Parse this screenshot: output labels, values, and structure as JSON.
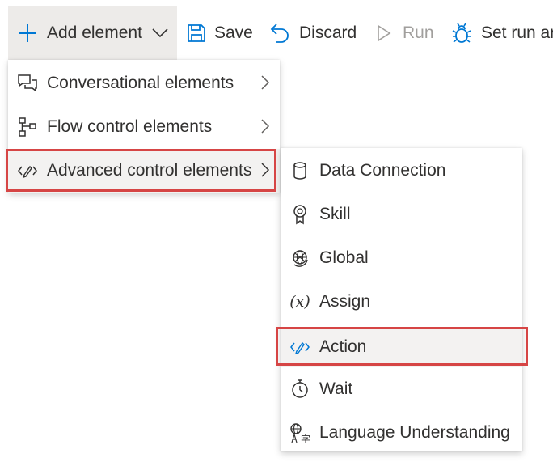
{
  "colors": {
    "accent": "#0078d4",
    "text": "#323130",
    "disabled": "#a19f9d",
    "highlight_outline": "#d64545",
    "hover_bg": "#f3f2f1",
    "pressed_bg": "#edebe9"
  },
  "toolbar": {
    "add_element": {
      "label": "Add element",
      "icon": "plus-icon",
      "dropdown_icon": "chevron-down-icon"
    },
    "save": {
      "label": "Save",
      "icon": "save-icon"
    },
    "discard": {
      "label": "Discard",
      "icon": "undo-icon"
    },
    "run": {
      "label": "Run",
      "icon": "play-icon",
      "disabled": true
    },
    "debug": {
      "label": "Set run ar",
      "icon": "bug-icon"
    }
  },
  "menu": {
    "items": [
      {
        "label": "Conversational elements",
        "icon": "chat-bubbles-icon",
        "has_submenu": true
      },
      {
        "label": "Flow control elements",
        "icon": "flow-chart-icon",
        "has_submenu": true
      },
      {
        "label": "Advanced control elements",
        "icon": "code-pen-icon",
        "has_submenu": true,
        "highlighted": true
      }
    ]
  },
  "submenu": {
    "items": [
      {
        "label": "Data Connection",
        "icon": "database-icon"
      },
      {
        "label": "Skill",
        "icon": "ribbon-badge-icon"
      },
      {
        "label": "Global",
        "icon": "globe-icon"
      },
      {
        "label": "Assign",
        "icon": "variable-x-icon",
        "glyph": "(x)"
      },
      {
        "label": "Action",
        "icon": "code-pen-icon",
        "highlighted": true
      },
      {
        "label": "Wait",
        "icon": "timer-icon"
      },
      {
        "label": "Language Understanding",
        "icon": "translate-icon"
      }
    ]
  }
}
